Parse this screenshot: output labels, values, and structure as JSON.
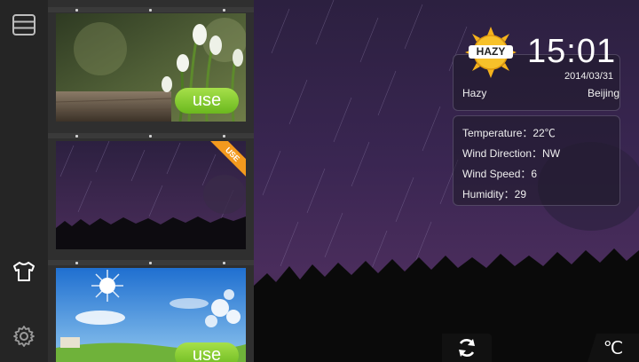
{
  "themes": [
    {
      "use_label": "use"
    },
    {
      "corner_label": "USE"
    },
    {
      "use_label": "use"
    }
  ],
  "weather": {
    "badge": "HAZY",
    "time": "15:01",
    "date": "2014/03/31",
    "condition": "Hazy",
    "city": "Beijing",
    "temperature": "Temperature：22℃",
    "wind_direction": "Wind Direction：NW",
    "wind_speed": "Wind Speed：6",
    "humidity": "Humidity：29"
  },
  "unit_button": "℃",
  "colors": {
    "accent_green": "#7ec82a",
    "accent_orange": "#f39a1e",
    "sun": "#f5b21c"
  },
  "icons": [
    "menu-icon",
    "shirt-icon",
    "gear-icon",
    "refresh-icon"
  ]
}
